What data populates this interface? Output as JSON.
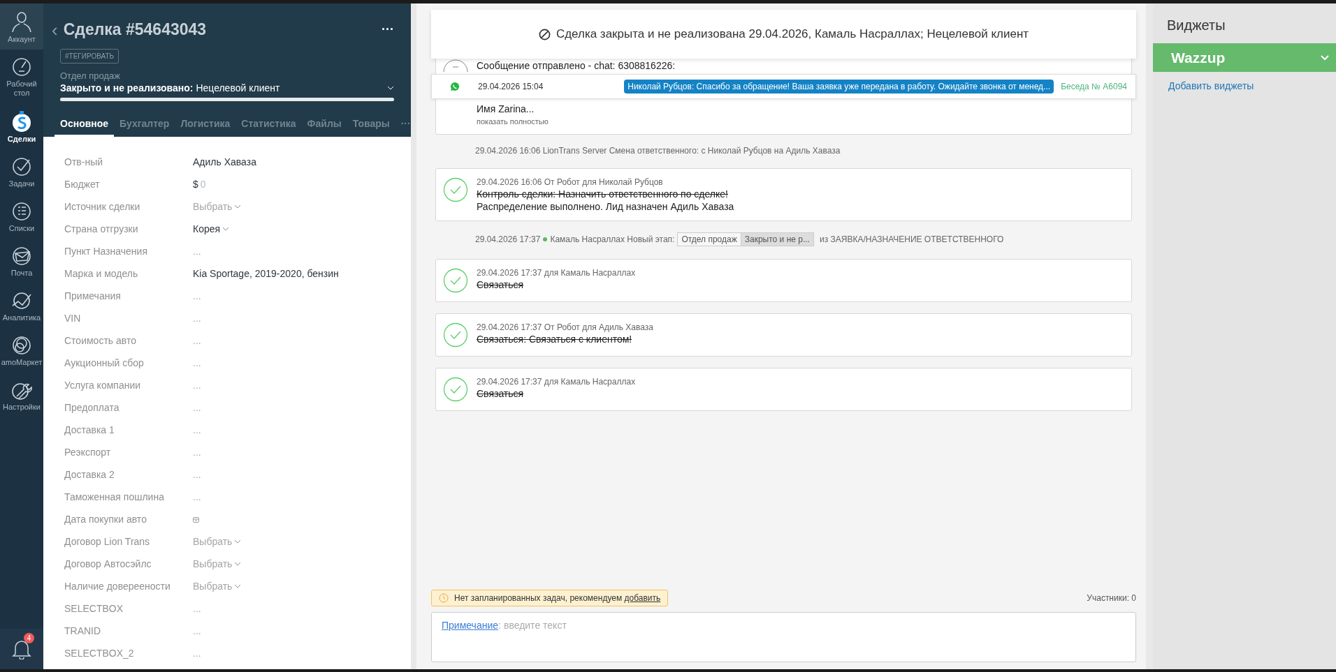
{
  "nav": {
    "items": [
      {
        "label": "Аккаунт",
        "kind": "avatar",
        "selected": false
      },
      {
        "label": "Рабочий стол",
        "kind": "dashboard",
        "selected": false
      },
      {
        "label": "Сделки",
        "kind": "deals",
        "selected": true
      },
      {
        "label": "Задачи",
        "kind": "tasks",
        "selected": false
      },
      {
        "label": "Списки",
        "kind": "lists",
        "selected": false
      },
      {
        "label": "Почта",
        "kind": "mail",
        "selected": false
      },
      {
        "label": "Аналитика",
        "kind": "analytics",
        "selected": false
      },
      {
        "label": "amoМаркет",
        "kind": "market",
        "selected": false
      },
      {
        "label": "Настройки",
        "kind": "settings",
        "selected": false
      }
    ],
    "notifications": {
      "badge": "4"
    }
  },
  "deal": {
    "back": "‹",
    "title": "Сделка #54643043",
    "more": "···",
    "tag_button": "#ТЕГИРОВАТЬ",
    "pipeline": "Отдел продаж",
    "status": "Закрыто и не реализовано:",
    "reason": "Нецелевой клиент",
    "progress": {
      "level": 1
    },
    "tabs": [
      {
        "label": "Основное",
        "selected": true
      },
      {
        "label": "Бухгалтер",
        "selected": false
      },
      {
        "label": "Логистика",
        "selected": false
      },
      {
        "label": "Статистика",
        "selected": false
      },
      {
        "label": "Файлы",
        "selected": false
      },
      {
        "label": "Товары",
        "selected": false
      }
    ],
    "tabs_more": "···",
    "fields": [
      {
        "label": "Отв-ный",
        "kind": "text",
        "value": "Адиль Хаваза"
      },
      {
        "label": "Бюджет",
        "kind": "money",
        "currency": "$",
        "value": "0"
      },
      {
        "label": "Источник сделки",
        "kind": "select_empty",
        "placeholder": "Выбрать"
      },
      {
        "label": "Страна отгрузки",
        "kind": "select",
        "value": "Корея"
      },
      {
        "label": "Пункт Назначения",
        "kind": "empty",
        "value": "..."
      },
      {
        "label": "Марка и модель",
        "kind": "text",
        "value": "Kia Sportage, 2019-2020, бензин"
      },
      {
        "label": "Примечания",
        "kind": "empty",
        "value": "..."
      },
      {
        "label": "VIN",
        "kind": "empty",
        "value": "..."
      },
      {
        "label": "Стоимость авто",
        "kind": "empty",
        "value": "..."
      },
      {
        "label": "Аукционный сбор",
        "kind": "empty",
        "value": "..."
      },
      {
        "label": "Услуга компании",
        "kind": "empty",
        "value": "..."
      },
      {
        "label": "Предоплата",
        "kind": "empty",
        "value": "..."
      },
      {
        "label": "Доставка 1",
        "kind": "empty",
        "value": "..."
      },
      {
        "label": "Реэкспорт",
        "kind": "empty",
        "value": "..."
      },
      {
        "label": "Доставка 2",
        "kind": "empty",
        "value": "..."
      },
      {
        "label": "Таможенная пошлина",
        "kind": "empty",
        "value": "..."
      },
      {
        "label": "Дата покупки авто",
        "kind": "date"
      },
      {
        "label": "Договор Lion Trans",
        "kind": "select_empty",
        "placeholder": "Выбрать"
      },
      {
        "label": "Договор Автосэйлс",
        "kind": "select_empty",
        "placeholder": "Выбрать"
      },
      {
        "label": "Наличие довереености",
        "kind": "select_empty",
        "placeholder": "Выбрать"
      },
      {
        "label": "SELECTBOX",
        "kind": "empty",
        "value": "..."
      },
      {
        "label": "TRANID",
        "kind": "empty",
        "value": "..."
      },
      {
        "label": "SELECTBOX_2",
        "kind": "empty",
        "value": "..."
      }
    ]
  },
  "feed": {
    "banner": "Сделка закрыта и не реализована 29.04.2026, Камаль Насраллах; Нецелевой клиент",
    "chat_bar": {
      "time": "29.04.2026 15:04",
      "message": "Николай Рубцов: Спасибо за обращение! Ваша заявка уже передана в работу. Ожидайте звонка от менед...",
      "conversation": "Беседа № А6094"
    },
    "items": [
      {
        "kind": "message",
        "lines": [
          "Сообщение отправлено - chat: 6308816226:",
          "Имя Zarina..."
        ],
        "link": "показать полностью"
      },
      {
        "kind": "system",
        "text": "29.04.2026 16:06 LionTrans Server Смена ответственного: с Николай Рубцов на Адиль Хаваза"
      },
      {
        "kind": "task",
        "meta": "29.04.2026 16:06  От Робот для Николай Рубцов",
        "lines": [
          {
            "text": "Контроль сделки: Назначить ответственного по сделке!",
            "struck": true
          },
          {
            "text": "Распределение выполнено. Лид назначен Адиль Хаваза",
            "struck": false
          }
        ]
      },
      {
        "kind": "stage",
        "time": "29.04.2026 17:37",
        "author": "Камаль Насраллах Новый этап:",
        "pipeline": "Отдел продаж",
        "stage": "Закрыто и не р...",
        "from": "из ЗАЯВКА/НАЗНАЧЕНИЕ ОТВЕТСТВЕННОГО"
      },
      {
        "kind": "task",
        "meta": "29.04.2026 17:37  для Камаль Насраллах",
        "lines": [
          {
            "text": "Связаться",
            "struck": true
          }
        ]
      },
      {
        "kind": "task",
        "meta": "29.04.2026 17:37  От Робот для Адиль Хаваза",
        "lines": [
          {
            "text": "Связаться: Связаться с клиентом!",
            "struck": true
          }
        ]
      },
      {
        "kind": "task",
        "meta": "29.04.2026 17:37  для Камаль Насраллах",
        "lines": [
          {
            "text": "Связаться",
            "struck": true
          }
        ]
      }
    ],
    "notice": {
      "text": "Нет запланированных задач, рекомендуем ",
      "link": "добавить"
    },
    "participants": "Участники: 0",
    "note": {
      "type": "Примечание",
      "separator": ":",
      "placeholder": "введите текст"
    }
  },
  "widgets": {
    "title": "Виджеты",
    "items": [
      {
        "label": "Wazzup",
        "expanded": false
      }
    ],
    "add_link": "Добавить виджеты"
  }
}
